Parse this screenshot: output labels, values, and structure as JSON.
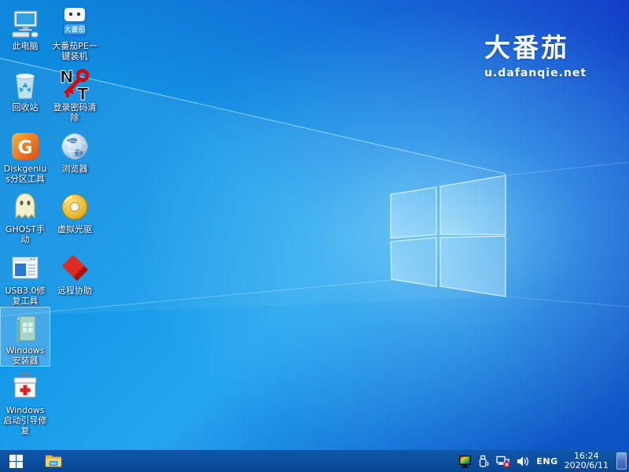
{
  "watermark": {
    "brand": "大番茄",
    "site": "u.dafanqie.net"
  },
  "desktop_icons": {
    "col1": [
      {
        "name": "this-pc",
        "label": "此电脑"
      },
      {
        "name": "recycle-bin",
        "label": "回收站"
      },
      {
        "name": "diskgenius",
        "label": "Diskgenius分区工具"
      },
      {
        "name": "ghost-manual",
        "label": "GHOST手动"
      },
      {
        "name": "usb3-repair",
        "label": "USB3.0修复工具"
      },
      {
        "name": "windows-installer",
        "label": "Windows安装器",
        "selected": true
      },
      {
        "name": "windows-boot-repair",
        "label": "Windows启动引导修复"
      }
    ],
    "col2": [
      {
        "name": "dafanqie-pe",
        "label": "大番茄PE一键装机",
        "badge": "大番茄"
      },
      {
        "name": "password-clear",
        "label": "登录密码清除"
      },
      {
        "name": "browser",
        "label": "浏览器"
      },
      {
        "name": "virtual-cd",
        "label": "虚拟光驱"
      },
      {
        "name": "remote-assist",
        "label": "远程协助"
      }
    ]
  },
  "taskbar": {
    "tray": {
      "language": "ENG",
      "time": "16:24",
      "date": "2020/6/11"
    },
    "icon_names": [
      "start-icon",
      "file-explorer-icon",
      "display-color-icon",
      "usb-device-icon",
      "network-disconnected-icon",
      "volume-icon",
      "show-desktop-button"
    ]
  },
  "colors": {
    "taskbar": "#0b4e9e",
    "wallpaper_left": "#0d88dc",
    "wallpaper_bright": "#25a5ef",
    "wallpaper_dark_corner": "#1234c3",
    "selection_highlight": "rgba(125,190,235,0.45)",
    "watermark_text": "#ffffff"
  }
}
